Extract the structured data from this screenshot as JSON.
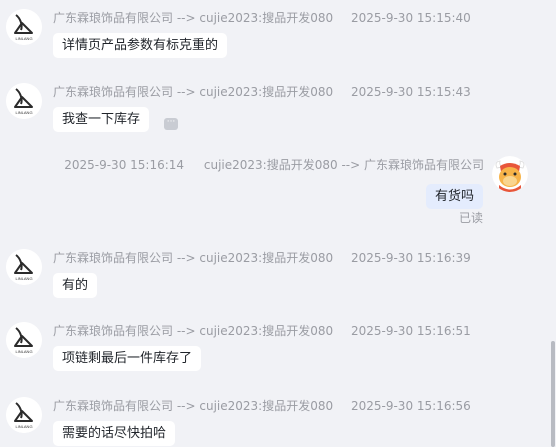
{
  "messages": [
    {
      "direction": "in",
      "sender": "广东霖琅饰品有限公司",
      "arrow": "-->",
      "receiver": "cujie2023:搜品开发080",
      "time": "2025-9-30 15:15:40",
      "text": "详情页产品参数有标克重的"
    },
    {
      "direction": "in",
      "sender": "广东霖琅饰品有限公司",
      "arrow": "-->",
      "receiver": "cujie2023:搜品开发080",
      "time": "2025-9-30 15:15:43",
      "text": "我查一下库存",
      "more_icon": "···"
    },
    {
      "direction": "out",
      "sender": "cujie2023:搜品开发080",
      "arrow": "-->",
      "receiver": "广东霖琅饰品有限公司",
      "time": "2025-9-30 15:16:14",
      "text": "有货吗",
      "status": "已读"
    },
    {
      "direction": "in",
      "sender": "广东霖琅饰品有限公司",
      "arrow": "-->",
      "receiver": "cujie2023:搜品开发080",
      "time": "2025-9-30 15:16:39",
      "text": "有的"
    },
    {
      "direction": "in",
      "sender": "广东霖琅饰品有限公司",
      "arrow": "-->",
      "receiver": "cujie2023:搜品开发080",
      "time": "2025-9-30 15:16:51",
      "text": "项链剩最后一件库存了"
    },
    {
      "direction": "in",
      "sender": "广东霖琅饰品有限公司",
      "arrow": "-->",
      "receiver": "cujie2023:搜品开发080",
      "time": "2025-9-30 15:16:56",
      "text": "需要的话尽快拍哈"
    }
  ],
  "brand_logo_text": "LINLANG",
  "icons": {
    "shop_avatar": "linlang-logo-avatar",
    "user_avatar": "cartoon-bull-avatar",
    "more": "ellipsis-icon"
  },
  "colors": {
    "background": "#f1f2f6",
    "incoming_bubble": "#ffffff",
    "outgoing_bubble": "#e4ecfd",
    "meta_text": "#9a9ca3"
  }
}
